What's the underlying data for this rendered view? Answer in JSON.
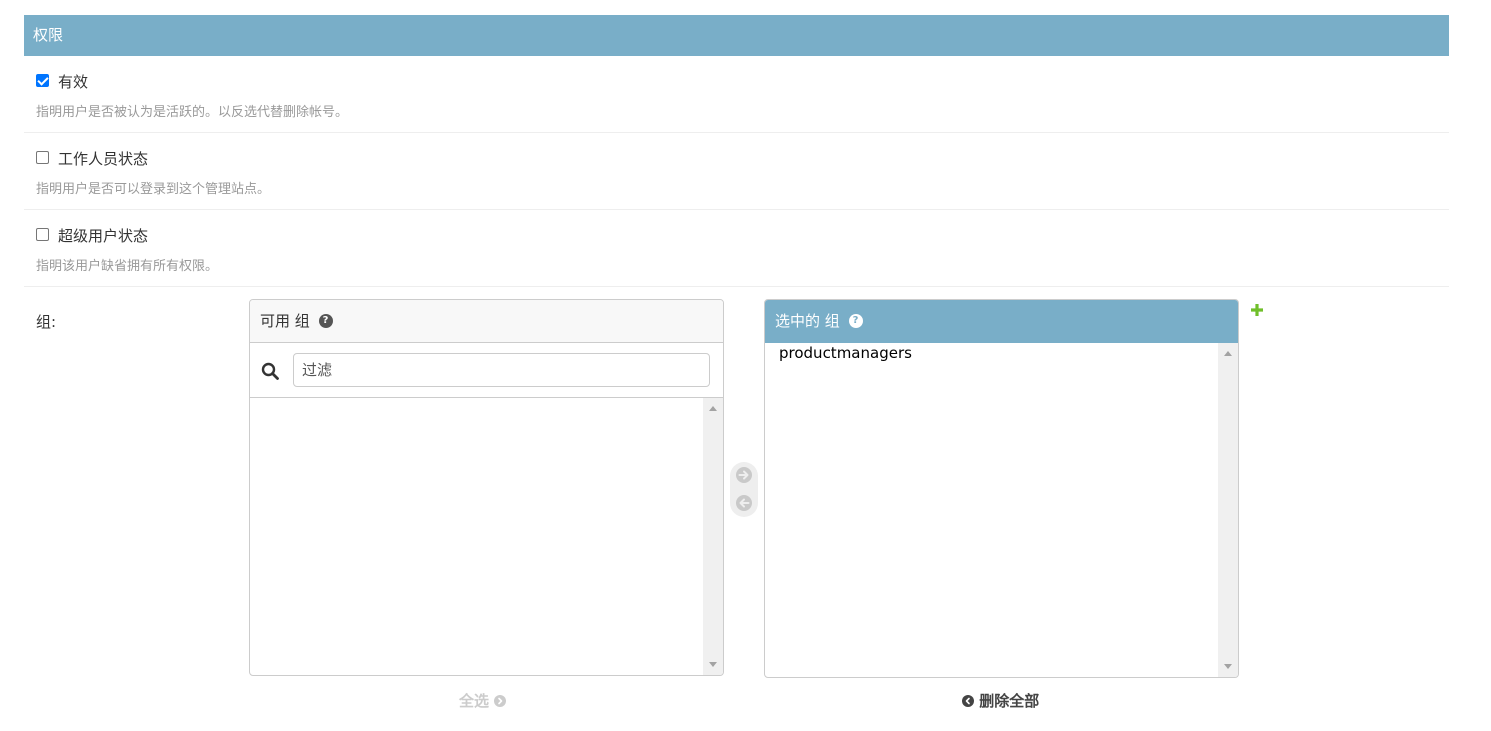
{
  "fieldset": {
    "title": "权限"
  },
  "fields": [
    {
      "label": "有效",
      "checked": true,
      "help": "指明用户是否被认为是活跃的。以反选代替删除帐号。"
    },
    {
      "label": "工作人员状态",
      "checked": false,
      "help": "指明用户是否可以登录到这个管理站点。"
    },
    {
      "label": "超级用户状态",
      "checked": false,
      "help": "指明该用户缺省拥有所有权限。"
    }
  ],
  "groups": {
    "label": "组:",
    "available": {
      "title": "可用 组",
      "filter_placeholder": "过滤",
      "items": [],
      "select_all_label": "全选"
    },
    "chosen": {
      "title": "选中的 组",
      "items": [
        "productmanagers"
      ],
      "remove_all_label": "删除全部"
    }
  },
  "colors": {
    "header": "#79aec8",
    "add_icon": "#70bf2b",
    "checkbox_checked": "#0075ff",
    "help_text": "#999999"
  },
  "icons": [
    "question-icon",
    "search-icon",
    "arrow-right-circle-icon",
    "arrow-left-circle-icon",
    "plus-icon",
    "chevron-right-circle-icon",
    "chevron-left-circle-icon"
  ]
}
